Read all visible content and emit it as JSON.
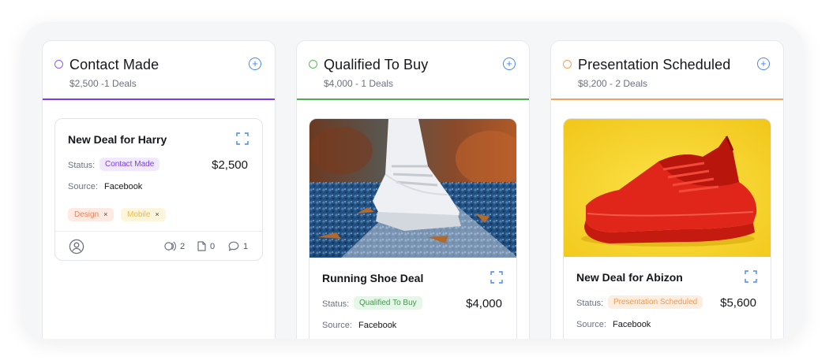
{
  "columns": [
    {
      "title": "Contact Made",
      "subtitle": "$2,500 -1 Deals",
      "color": "#7c3aed",
      "cards": [
        {
          "title": "New Deal for Harry",
          "status_label": "Status:",
          "status": "Contact Made",
          "amount": "$2,500",
          "source_label": "Source:",
          "source": "Facebook",
          "tags": [
            {
              "label": "Design",
              "remove": "×"
            },
            {
              "label": "Mobile",
              "remove": "×"
            }
          ],
          "footer": {
            "voice_count": "2",
            "file_count": "0",
            "comment_count": "1"
          }
        }
      ]
    },
    {
      "title": "Qualified To Buy",
      "subtitle": "$4,000 - 1 Deals",
      "color": "#4caf50",
      "cards": [
        {
          "image": "white-running-shoe-photo",
          "title": "Running Shoe Deal",
          "status_label": "Status:",
          "status": "Qualified To Buy",
          "amount": "$4,000",
          "source_label": "Source:",
          "source": "Facebook"
        }
      ]
    },
    {
      "title": "Presentation Scheduled",
      "subtitle": "$8,200 - 2 Deals",
      "color": "#f5a05a",
      "cards": [
        {
          "image": "red-sneaker-photo",
          "title": "New Deal for Abizon",
          "status_label": "Status:",
          "status": "Presentation Scheduled",
          "amount": "$5,600",
          "source_label": "Source:",
          "source": "Facebook"
        }
      ]
    }
  ],
  "colors": {
    "purple": "#7c3aed",
    "green": "#4caf50",
    "orange": "#f5a05a",
    "blue_icon": "#4a86e8"
  }
}
